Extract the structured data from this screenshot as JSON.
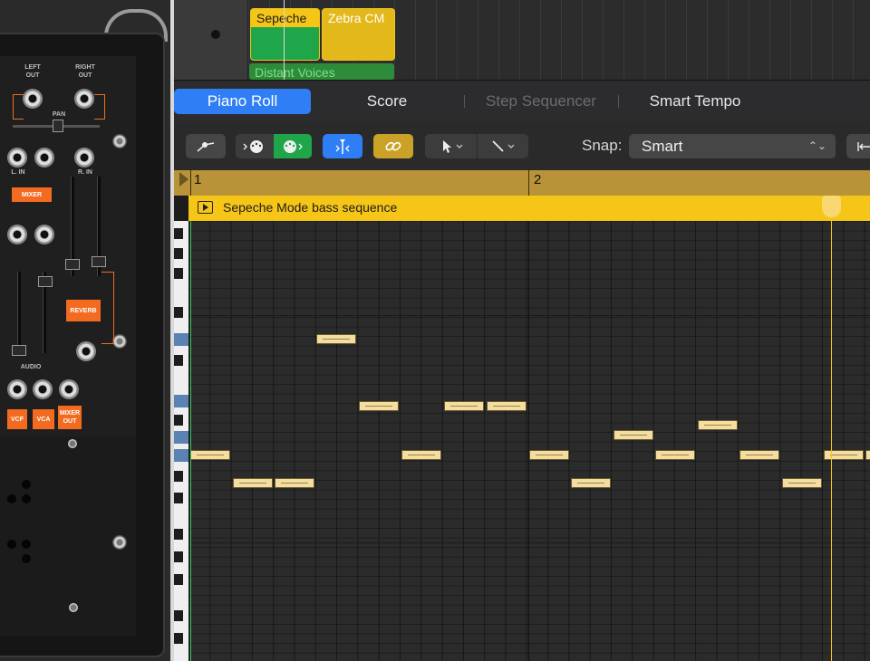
{
  "synth": {
    "left_out": "LEFT\nOUT",
    "right_out": "RIGHT\nOUT",
    "pan": "PAN",
    "l_in": "L. IN",
    "r_in": "R. IN",
    "mixer": "MIXER",
    "reverb": "REVERB",
    "audio": "AUDIO",
    "vcf": "VCF",
    "vca": "VCA",
    "mixer_out": "MIXER\nOUT"
  },
  "tracks": {
    "regions": [
      {
        "name": "Sepeche",
        "color": "#1fa64a"
      },
      {
        "name": "Zebra CM",
        "color": "#e3b81b"
      },
      {
        "name": "Distant Voices",
        "color": "#2e8b3a"
      }
    ]
  },
  "tabs": [
    {
      "label": "Piano Roll",
      "state": "active"
    },
    {
      "label": "Score",
      "state": "normal"
    },
    {
      "label": "Step Sequencer",
      "state": "disabled"
    },
    {
      "label": "Smart Tempo",
      "state": "normal"
    }
  ],
  "toolbar": {
    "snap_label": "Snap:",
    "snap_value": "Smart",
    "icons": [
      "automation-icon",
      "midi-in-icon",
      "midi-out-icon",
      "catch-playhead-icon",
      "link-icon",
      "pointer-tool-icon",
      "pencil-tool-icon",
      "collapse-icon"
    ]
  },
  "ruler": {
    "bars": [
      "1",
      "2"
    ]
  },
  "region": {
    "name": "Sepeche Mode bass sequence"
  },
  "colors": {
    "accent": "#2f7ef5",
    "region": "#f5c518",
    "note_fill": "#f4dda0",
    "start_line": "#34c759"
  }
}
